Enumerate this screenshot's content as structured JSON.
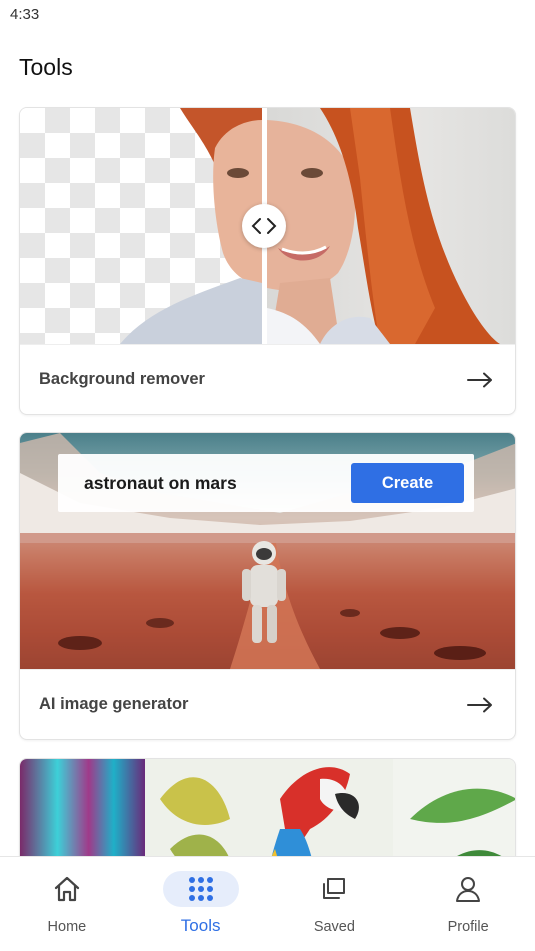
{
  "status_bar": {
    "time": "4:33"
  },
  "page": {
    "title": "Tools"
  },
  "tools": [
    {
      "label": "Background remover"
    },
    {
      "label": "AI image generator",
      "prompt": "astronaut on mars",
      "action": "Create"
    }
  ],
  "nav": {
    "items": [
      {
        "label": "Home",
        "icon": "home-icon"
      },
      {
        "label": "Tools",
        "icon": "grid-icon",
        "active": true
      },
      {
        "label": "Saved",
        "icon": "saved-icon"
      },
      {
        "label": "Profile",
        "icon": "profile-icon"
      }
    ]
  },
  "colors": {
    "accent": "#2f6fe4",
    "accent_soft": "#e6edfb"
  }
}
